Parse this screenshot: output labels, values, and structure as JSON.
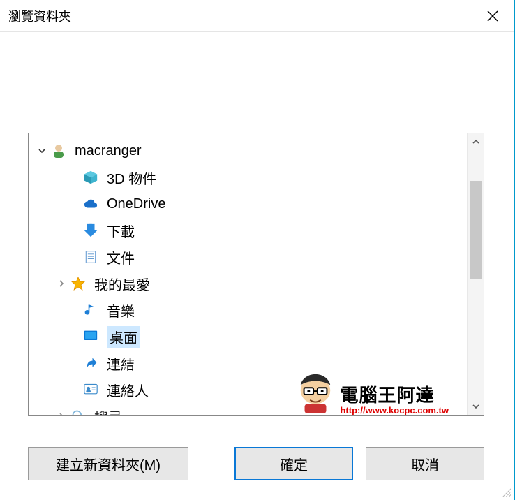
{
  "dialog": {
    "title": "瀏覽資料夾"
  },
  "tree": {
    "root": {
      "label": "macranger"
    },
    "items": [
      {
        "label": "3D 物件"
      },
      {
        "label": "OneDrive"
      },
      {
        "label": "下載"
      },
      {
        "label": "文件"
      },
      {
        "label": "我的最愛"
      },
      {
        "label": "音樂"
      },
      {
        "label": "桌面",
        "selected": true
      },
      {
        "label": "連結"
      },
      {
        "label": "連絡人"
      },
      {
        "label": "搜尋"
      }
    ]
  },
  "buttons": {
    "new_folder": "建立新資料夾(M)",
    "ok": "確定",
    "cancel": "取消"
  },
  "watermark": {
    "title": "電腦王阿達",
    "url": "http://www.kocpc.com.tw"
  }
}
